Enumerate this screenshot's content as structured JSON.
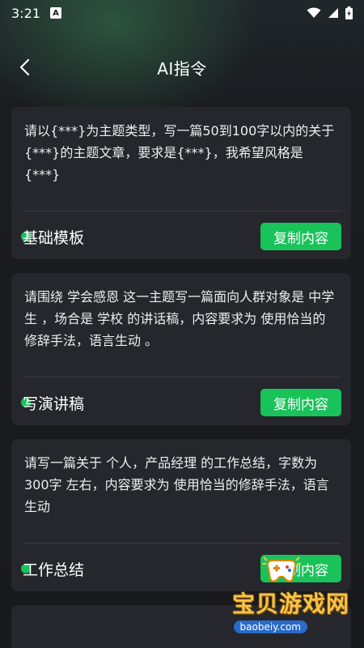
{
  "status_bar": {
    "time": "3:21",
    "notification_letter": "A"
  },
  "header": {
    "title": "AI指令"
  },
  "cards": [
    {
      "text": "请以{***}为主题类型，写一篇50到100字以内的关于{***}的主题文章，要求是{***}，我希望风格是{***}",
      "tag": "基础模板",
      "button": "复制内容"
    },
    {
      "text": "请围绕 学会感恩 这一主题写一篇面向人群对象是 中学生 ，场合是 学校 的讲话稿，内容要求为 使用恰当的修辞手法，语言生动 。",
      "tag": "写演讲稿",
      "button": "复制内容"
    },
    {
      "text": "请写一篇关于 个人，产品经理 的工作总结，字数为300字 左右，内容要求为 使用恰当的修辞手法，语言生动",
      "tag": "工作总结",
      "button": "复制内容"
    }
  ],
  "watermark": {
    "text": "宝贝游戏网",
    "url": "baobeiy.com"
  },
  "colors": {
    "accent": "#19c35a",
    "background": "#18191d",
    "card": "#25272c"
  }
}
